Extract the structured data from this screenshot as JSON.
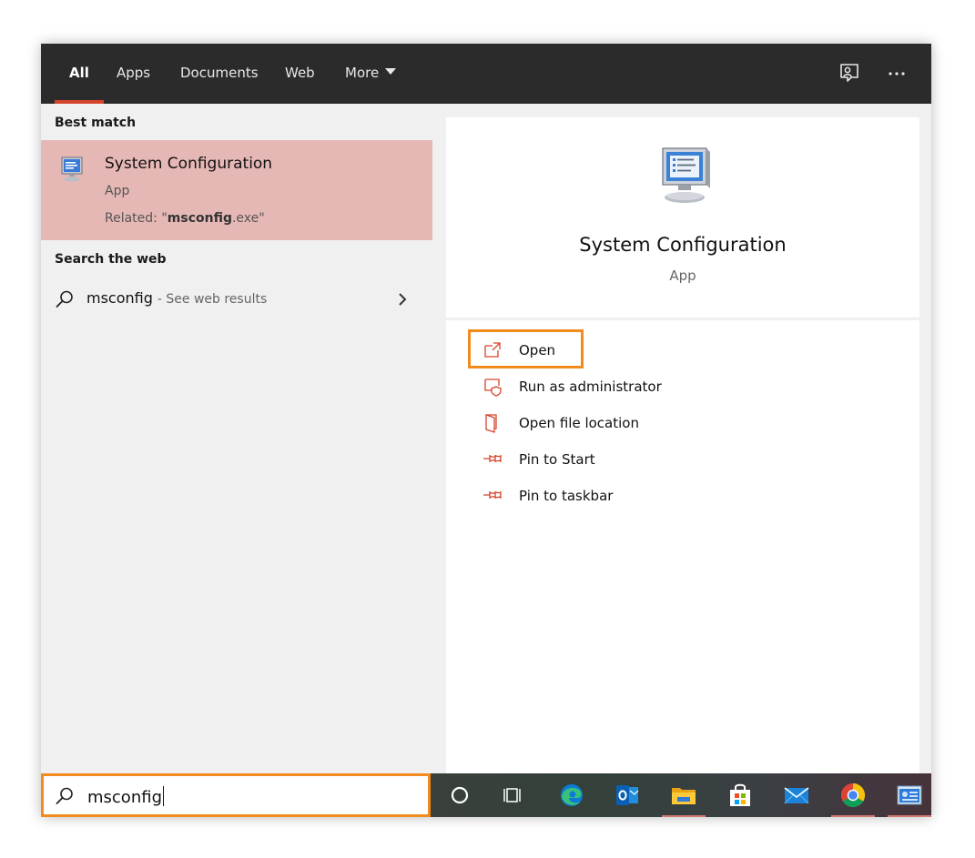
{
  "tabs": [
    {
      "label": "All",
      "active": true
    },
    {
      "label": "Apps"
    },
    {
      "label": "Documents"
    },
    {
      "label": "Web"
    },
    {
      "label": "More"
    }
  ],
  "top_icons": [
    "feedback-icon",
    "more-options-icon"
  ],
  "best_match": {
    "section_label": "Best match",
    "title": "System Configuration",
    "type": "App",
    "related_prefix": "Related: \"",
    "related_term": "msconfig",
    "related_suffix": ".exe\""
  },
  "web": {
    "section_label": "Search the web",
    "term": "msconfig",
    "hint": "- See web results"
  },
  "detail": {
    "title": "System Configuration",
    "type": "App",
    "actions": [
      {
        "label": "Open",
        "icon": "open-icon"
      },
      {
        "label": "Run as administrator",
        "icon": "admin-shield-icon"
      },
      {
        "label": "Open file location",
        "icon": "file-location-icon"
      },
      {
        "label": "Pin to Start",
        "icon": "pin-icon"
      },
      {
        "label": "Pin to taskbar",
        "icon": "pin-icon"
      }
    ]
  },
  "search": {
    "value": "msconfig"
  },
  "taskbar": [
    "cortana-icon",
    "task-view-icon",
    "edge-icon",
    "outlook-icon",
    "file-explorer-icon",
    "store-icon",
    "mail-icon",
    "chrome-icon",
    "control-panel-icon"
  ],
  "colors": {
    "accent": "#d7432b",
    "highlight_border": "#f28a1c",
    "selection": "#e6b8b5",
    "topbar": "#2b2b2b"
  }
}
